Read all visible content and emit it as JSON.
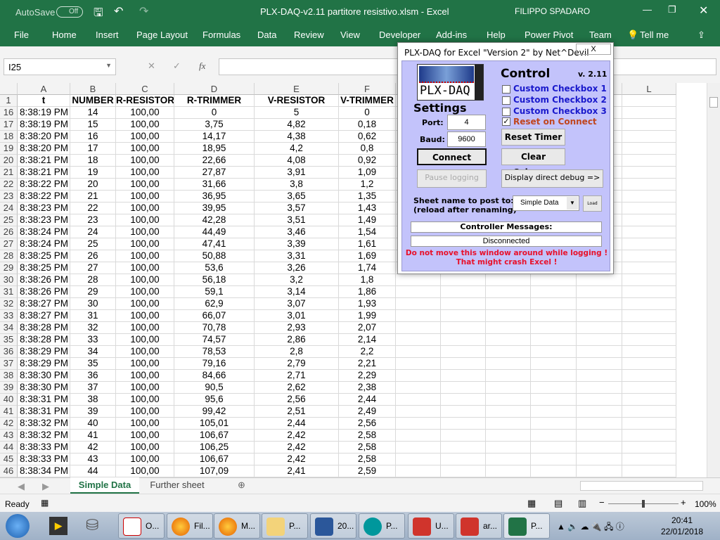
{
  "titlebar": {
    "autosave": "AutoSave",
    "autosave_state": "Off",
    "title": "PLX-DAQ-v2.11 partitore resistivo.xlsm  -  Excel",
    "user": "FILIPPO SPADARO"
  },
  "ribbon": {
    "tabs": [
      "File",
      "Home",
      "Insert",
      "Page Layout",
      "Formulas",
      "Data",
      "Review",
      "View",
      "Developer",
      "Add-ins",
      "Help",
      "Power Pivot",
      "Team"
    ],
    "tell_me": "Tell me"
  },
  "formula_bar": {
    "name_box": "I25",
    "fx": "fx",
    "value": ""
  },
  "grid": {
    "columns": [
      "A",
      "B",
      "C",
      "D",
      "E",
      "F",
      "G",
      "H",
      "I",
      "J",
      "K",
      "L"
    ],
    "header_row": {
      "num": "1",
      "cells": [
        "t",
        "NUMBER",
        "R-RESISTOR",
        "R-TRIMMER",
        "V-RESISTOR",
        "V-TRIMMER"
      ]
    },
    "rows": [
      [
        "16",
        "8:38:19 PM",
        "14",
        "100,00",
        "0",
        "5",
        "0"
      ],
      [
        "17",
        "8:38:19 PM",
        "15",
        "100,00",
        "3,75",
        "4,82",
        "0,18"
      ],
      [
        "18",
        "8:38:20 PM",
        "16",
        "100,00",
        "14,17",
        "4,38",
        "0,62"
      ],
      [
        "19",
        "8:38:20 PM",
        "17",
        "100,00",
        "18,95",
        "4,2",
        "0,8"
      ],
      [
        "20",
        "8:38:21 PM",
        "18",
        "100,00",
        "22,66",
        "4,08",
        "0,92"
      ],
      [
        "21",
        "8:38:21 PM",
        "19",
        "100,00",
        "27,87",
        "3,91",
        "1,09"
      ],
      [
        "22",
        "8:38:22 PM",
        "20",
        "100,00",
        "31,66",
        "3,8",
        "1,2"
      ],
      [
        "23",
        "8:38:22 PM",
        "21",
        "100,00",
        "36,95",
        "3,65",
        "1,35"
      ],
      [
        "24",
        "8:38:23 PM",
        "22",
        "100,00",
        "39,95",
        "3,57",
        "1,43"
      ],
      [
        "25",
        "8:38:23 PM",
        "23",
        "100,00",
        "42,28",
        "3,51",
        "1,49"
      ],
      [
        "26",
        "8:38:24 PM",
        "24",
        "100,00",
        "44,49",
        "3,46",
        "1,54"
      ],
      [
        "27",
        "8:38:24 PM",
        "25",
        "100,00",
        "47,41",
        "3,39",
        "1,61"
      ],
      [
        "28",
        "8:38:25 PM",
        "26",
        "100,00",
        "50,88",
        "3,31",
        "1,69"
      ],
      [
        "29",
        "8:38:25 PM",
        "27",
        "100,00",
        "53,6",
        "3,26",
        "1,74"
      ],
      [
        "30",
        "8:38:26 PM",
        "28",
        "100,00",
        "56,18",
        "3,2",
        "1,8"
      ],
      [
        "31",
        "8:38:26 PM",
        "29",
        "100,00",
        "59,1",
        "3,14",
        "1,86"
      ],
      [
        "32",
        "8:38:27 PM",
        "30",
        "100,00",
        "62,9",
        "3,07",
        "1,93"
      ],
      [
        "33",
        "8:38:27 PM",
        "31",
        "100,00",
        "66,07",
        "3,01",
        "1,99"
      ],
      [
        "34",
        "8:38:28 PM",
        "32",
        "100,00",
        "70,78",
        "2,93",
        "2,07"
      ],
      [
        "35",
        "8:38:28 PM",
        "33",
        "100,00",
        "74,57",
        "2,86",
        "2,14"
      ],
      [
        "36",
        "8:38:29 PM",
        "34",
        "100,00",
        "78,53",
        "2,8",
        "2,2"
      ],
      [
        "37",
        "8:38:29 PM",
        "35",
        "100,00",
        "79,16",
        "2,79",
        "2,21"
      ],
      [
        "38",
        "8:38:30 PM",
        "36",
        "100,00",
        "84,66",
        "2,71",
        "2,29"
      ],
      [
        "39",
        "8:38:30 PM",
        "37",
        "100,00",
        "90,5",
        "2,62",
        "2,38"
      ],
      [
        "40",
        "8:38:31 PM",
        "38",
        "100,00",
        "95,6",
        "2,56",
        "2,44"
      ],
      [
        "41",
        "8:38:31 PM",
        "39",
        "100,00",
        "99,42",
        "2,51",
        "2,49"
      ],
      [
        "42",
        "8:38:32 PM",
        "40",
        "100,00",
        "105,01",
        "2,44",
        "2,56"
      ],
      [
        "43",
        "8:38:32 PM",
        "41",
        "100,00",
        "106,67",
        "2,42",
        "2,58"
      ],
      [
        "44",
        "8:38:33 PM",
        "42",
        "100,00",
        "106,25",
        "2,42",
        "2,58"
      ],
      [
        "45",
        "8:38:33 PM",
        "43",
        "100,00",
        "106,67",
        "2,42",
        "2,58"
      ],
      [
        "46",
        "8:38:34 PM",
        "44",
        "100,00",
        "107,09",
        "2,41",
        "2,59"
      ]
    ]
  },
  "sheets": {
    "tabs": [
      "Simple Data",
      "Further sheet"
    ],
    "active": "Simple Data"
  },
  "status": {
    "ready": "Ready",
    "zoom": "100%"
  },
  "dialog": {
    "title": "PLX-DAQ for Excel \"Version 2\" by Net^Devil",
    "logo": "PLX-DAQ",
    "logo_side": "PARALLAX",
    "control": "Control",
    "version": "v. 2.11",
    "settings": "Settings",
    "checkboxes": [
      {
        "label": "Custom Checkbox 1",
        "checked": false
      },
      {
        "label": "Custom Checkbox 2",
        "checked": false
      },
      {
        "label": "Custom Checkbox 3",
        "checked": false
      },
      {
        "label": "Reset on Connect",
        "checked": true
      }
    ],
    "port_label": "Port:",
    "port": "4",
    "baud_label": "Baud:",
    "baud": "9600",
    "reset_timer": "Reset Timer",
    "clear_columns": "Clear Columns",
    "connect": "Connect",
    "pause": "Pause logging",
    "debug": "Display direct debug =>",
    "sheet_label_1": "Sheet name to post to:",
    "sheet_label_2": "(reload after renaming)",
    "sheet_select": "Simple Data",
    "load": "Load",
    "messages_label": "Controller Messages:",
    "message": "Disconnected",
    "warning_1": "Do not move this window around while logging !",
    "warning_2": "That might crash Excel !",
    "close": "X"
  },
  "taskbar": {
    "items": [
      "O...",
      "Fil...",
      "M...",
      "P...",
      "20...",
      "P...",
      "U...",
      "ar...",
      "P..."
    ],
    "time": "20:41",
    "date": "22/01/2018"
  },
  "colors": {
    "excel_green": "#217346",
    "dialog_bg": "#c3c3fb",
    "warning": "#e8102a",
    "checkbox_label": "#1a1acc",
    "reset_label": "#c0451d"
  }
}
